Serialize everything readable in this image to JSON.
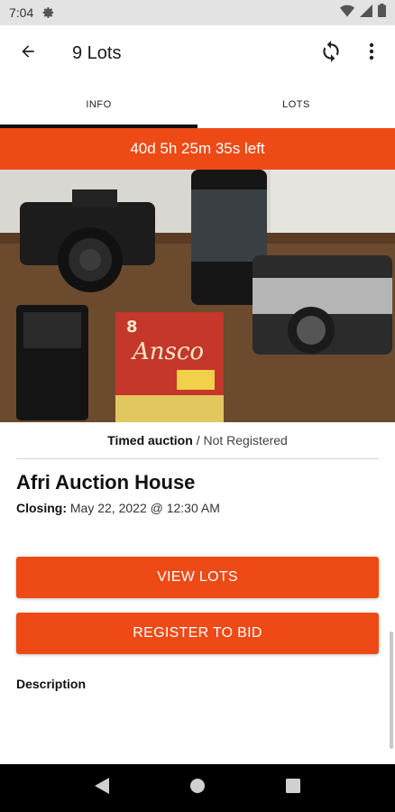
{
  "status_bar": {
    "time": "7:04",
    "icons": [
      "gear-icon",
      "wifi-icon",
      "cell-signal-icon",
      "battery-icon"
    ]
  },
  "app_bar": {
    "title": "9 Lots",
    "icons": [
      "back-arrow-icon",
      "refresh-icon",
      "more-vert-icon"
    ]
  },
  "tabs": [
    {
      "label": "INFO",
      "active": true
    },
    {
      "label": "LOTS",
      "active": false
    }
  ],
  "countdown": {
    "text": "40d 5h 25m 35s left"
  },
  "photo": {
    "description_icon": "auction-photo"
  },
  "auction": {
    "type": "Timed auction",
    "separator": "/",
    "registration": "Not Registered",
    "house_name": "Afri Auction House",
    "closing_label": "Closing:",
    "closing_value": "May 22, 2022 @ 12:30 AM"
  },
  "buttons": {
    "view_lots": "VIEW LOTS",
    "register": "REGISTER TO BID"
  },
  "description_label": "Description",
  "nav_bar": {
    "icons": [
      "back-triangle-icon",
      "home-circle-icon",
      "recents-square-icon"
    ]
  },
  "colors": {
    "accent": "#ee4a16",
    "status_bar": "#e3e3e3",
    "nav_bar": "#000000"
  }
}
